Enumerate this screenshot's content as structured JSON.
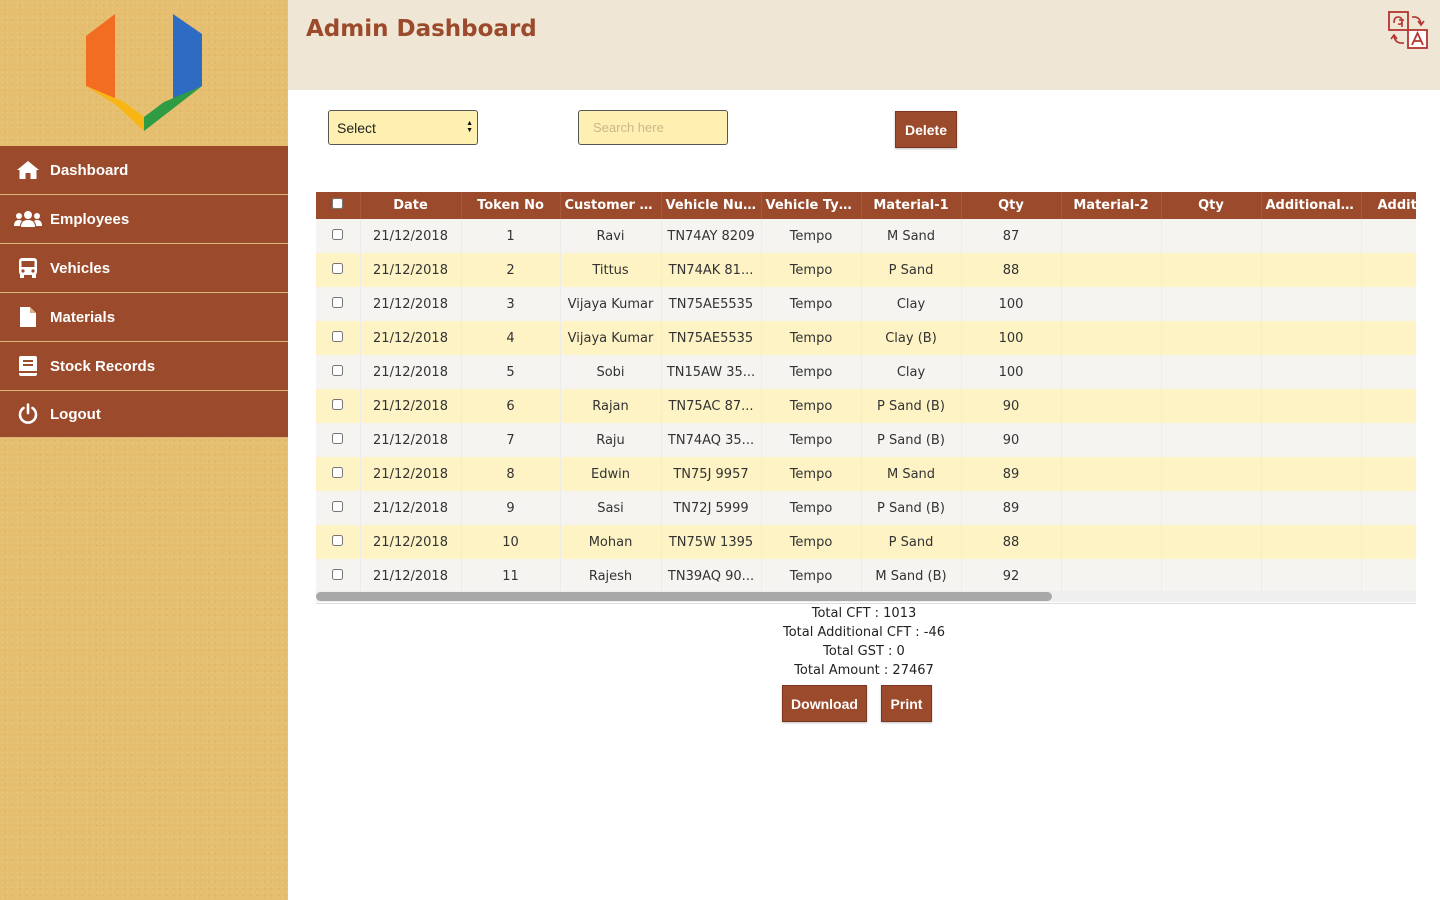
{
  "header": {
    "title": "Admin Dashboard"
  },
  "colors": {
    "brand": "#9b4a2b",
    "sidebar_bg": "#e5bf6f",
    "header_bg": "#efe6d6",
    "row_highlight": "#fdf3c4"
  },
  "sidebar": {
    "items": [
      {
        "label": "Dashboard",
        "icon": "home-icon"
      },
      {
        "label": "Employees",
        "icon": "users-icon"
      },
      {
        "label": "Vehicles",
        "icon": "bus-icon"
      },
      {
        "label": "Materials",
        "icon": "file-icon"
      },
      {
        "label": "Stock Records",
        "icon": "book-icon"
      },
      {
        "label": "Logout",
        "icon": "power-icon"
      }
    ]
  },
  "toolbar": {
    "select_value": "Select",
    "search_placeholder": "Search here",
    "delete_label": "Delete"
  },
  "table": {
    "columns": [
      "Date",
      "Token No",
      "Customer N...",
      "Vehicle Num...",
      "Vehicle Type",
      "Material-1",
      "Qty",
      "Material-2",
      "Qty",
      "Additional ...",
      "Addition"
    ],
    "rows": [
      [
        "21/12/2018",
        "1",
        "Ravi",
        "TN74AY 8209",
        "Tempo",
        "M Sand",
        "87",
        "",
        "",
        "",
        ""
      ],
      [
        "21/12/2018",
        "2",
        "Tittus",
        "TN74AK 81...",
        "Tempo",
        "P Sand",
        "88",
        "",
        "",
        "",
        ""
      ],
      [
        "21/12/2018",
        "3",
        "Vijaya Kumar",
        "TN75AE5535",
        "Tempo",
        "Clay",
        "100",
        "",
        "",
        "",
        ""
      ],
      [
        "21/12/2018",
        "4",
        "Vijaya Kumar",
        "TN75AE5535",
        "Tempo",
        "Clay (B)",
        "100",
        "",
        "",
        "",
        ""
      ],
      [
        "21/12/2018",
        "5",
        "Sobi",
        "TN15AW 35...",
        "Tempo",
        "Clay",
        "100",
        "",
        "",
        "",
        ""
      ],
      [
        "21/12/2018",
        "6",
        "Rajan",
        "TN75AC 87...",
        "Tempo",
        "P Sand (B)",
        "90",
        "",
        "",
        "",
        ""
      ],
      [
        "21/12/2018",
        "7",
        "Raju",
        "TN74AQ 35...",
        "Tempo",
        "P Sand (B)",
        "90",
        "",
        "",
        "",
        ""
      ],
      [
        "21/12/2018",
        "8",
        "Edwin",
        "TN75J 9957",
        "Tempo",
        "M Sand",
        "89",
        "",
        "",
        "",
        ""
      ],
      [
        "21/12/2018",
        "9",
        "Sasi",
        "TN72J 5999",
        "Tempo",
        "P Sand (B)",
        "89",
        "",
        "",
        "",
        ""
      ],
      [
        "21/12/2018",
        "10",
        "Mohan",
        "TN75W 1395",
        "Tempo",
        "P Sand",
        "88",
        "",
        "",
        "",
        ""
      ],
      [
        "21/12/2018",
        "11",
        "Rajesh",
        "TN39AQ 90...",
        "Tempo",
        "M Sand (B)",
        "92",
        "",
        "",
        "",
        ""
      ]
    ]
  },
  "totals": {
    "cft": "Total CFT : 1013",
    "additional_cft": "Total Additional CFT : -46",
    "gst": "Total GST : 0",
    "amount": "Total Amount : 27467"
  },
  "actions": {
    "download_label": "Download",
    "print_label": "Print"
  }
}
